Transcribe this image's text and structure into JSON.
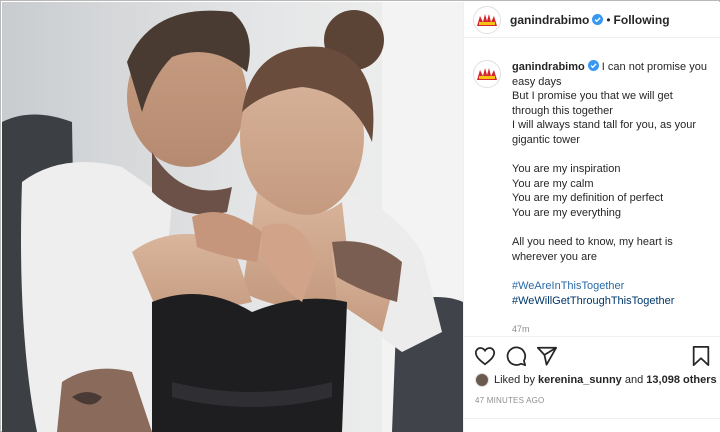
{
  "post": {
    "author": {
      "username": "ganindrabimo",
      "verified": true,
      "avatar_icon": "power-rangers-logo-icon"
    },
    "follow_status": "Following",
    "separator": "•",
    "caption": {
      "lines": [
        "I can not promise you easy days",
        "But I promise you that we will get through this together",
        "I will always stand tall for you, as your gigantic tower",
        "",
        "You are my inspiration",
        "You are my calm",
        "You are my definition of perfect",
        "You are my everything",
        "",
        "All you need to know, my heart is wherever you are",
        ""
      ],
      "hashtags": [
        "#WeAreInThisTogether",
        "#WeWillGetThroughThisTogether"
      ],
      "time_ago": "47m"
    },
    "actions": {
      "like_icon": "heart-icon",
      "comment_icon": "comment-icon",
      "share_icon": "paper-plane-icon",
      "save_icon": "bookmark-icon"
    },
    "likes": {
      "prefix": "Liked by",
      "first_user": "kerenina_sunny",
      "joiner": "and",
      "others": "13,098 others"
    },
    "timestamp": "47 MINUTES AGO"
  },
  "colors": {
    "verified": "#3897f0",
    "hashtag": "#00376b",
    "muted": "#8e8e8e",
    "logo_red": "#d7262b",
    "logo_yellow": "#f6c315"
  }
}
